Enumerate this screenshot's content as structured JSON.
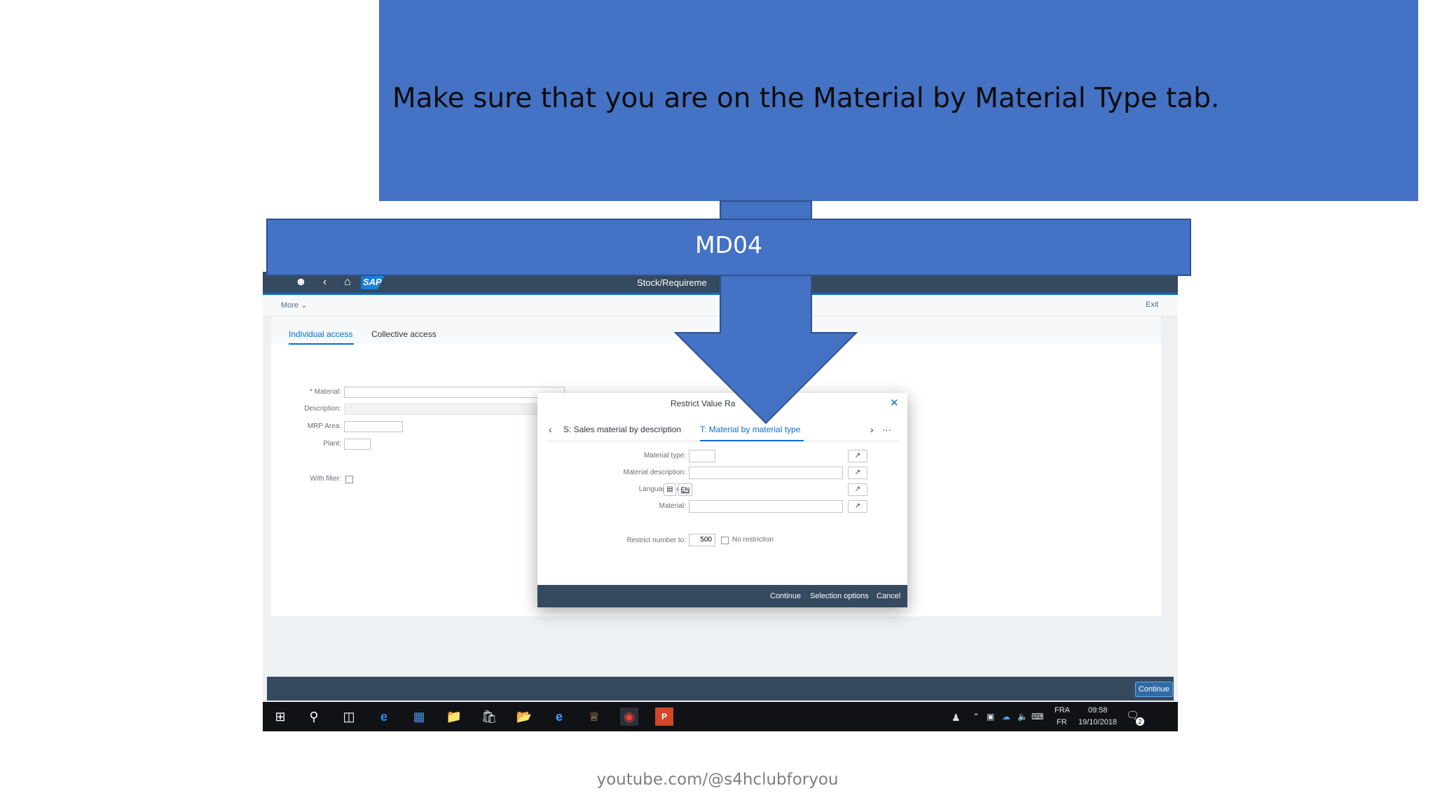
{
  "slide": {
    "callout_text": "Make sure that you are on the Material by Material Type tab.",
    "banner_text": "MD04",
    "footer": "youtube.com/@s4hclubforyou",
    "colors": {
      "slide_blue": "#4472c4",
      "sap_shell": "#354a5f",
      "sap_accent": "#0a6ed1"
    }
  },
  "sap": {
    "shell": {
      "logo": "SAP",
      "title": "Stock/Requireme",
      "icons": [
        "user-icon",
        "back-icon",
        "home-icon"
      ]
    },
    "toolbar": {
      "more": "More",
      "exit": "Exit"
    },
    "tabs": [
      {
        "label": "Individual access",
        "selected": true
      },
      {
        "label": "Collective access",
        "selected": false
      }
    ],
    "form": {
      "material_label": "* Material:",
      "description_label": "Description:",
      "mrp_area_label": "MRP Area:",
      "plant_label": "Plant:",
      "with_filter_label": "With filter:"
    },
    "bottom_continue": "Continue"
  },
  "dialog": {
    "title": "Restrict Value Ra",
    "tabs": [
      {
        "label": "S: Sales material by description",
        "selected": false
      },
      {
        "label": "T: Material by material type",
        "selected": true
      }
    ],
    "fields": {
      "material_type_label": "Material type:",
      "material_description_label": "Material description:",
      "language_key_label": "Language Key:",
      "language_key_value": "EN",
      "material_label": "Material:"
    },
    "restrict_label": "Restrict number to:",
    "restrict_value": "500",
    "no_restriction_label": "No restriction",
    "footer_buttons": {
      "continue": "Continue",
      "selection_options": "Selection options",
      "cancel": "Cancel"
    }
  },
  "taskbar": {
    "language": "FRA",
    "layout": "FR",
    "time": "09:58",
    "date": "19/10/2018",
    "notifications": "2"
  }
}
